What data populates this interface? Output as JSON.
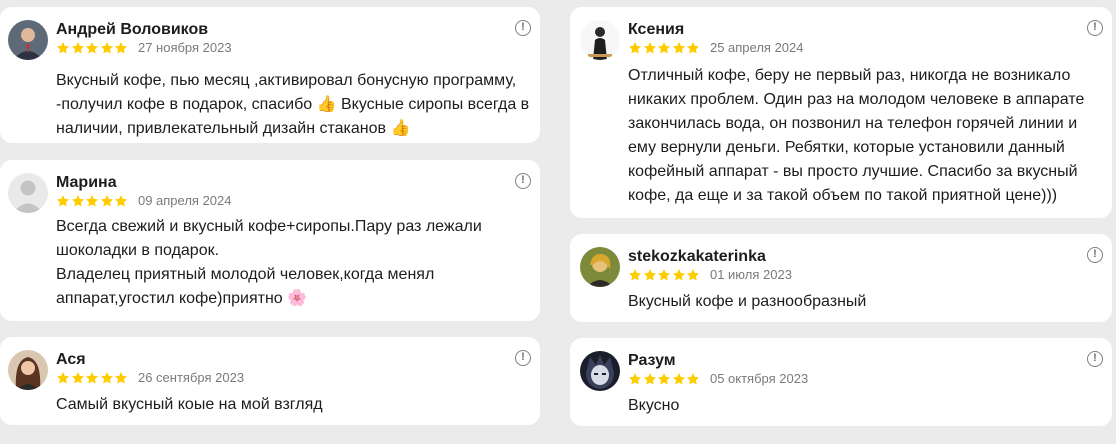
{
  "colors": {
    "page_background": "#ebebeb",
    "card_background": "#ffffff",
    "star": "#ffcc00",
    "date_text": "#7a7a7a",
    "body_text": "#1d1d1d"
  },
  "info_icon_glyph": "!",
  "reviews": [
    {
      "author": "Андрей Воловиков",
      "rating": 5,
      "date": "27 ноября 2023",
      "lines": [
        "Вкусный кофе, пью месяц ,активировал бонусную программу,",
        "-получил кофе в подарок, спасибо 👍  Вкусные сиропы всегда в",
        "наличии, привлекательный дизайн стаканов 👍"
      ]
    },
    {
      "author": "Марина",
      "rating": 5,
      "date": "09 апреля 2024",
      "lines": [
        "Всегда свежий и вкусный кофе+сиропы.Пару раз лежали",
        "шоколадки в подарок.",
        "Владелец приятный молодой человек,когда менял",
        "аппарат,угостил кофе)приятно 🌸"
      ]
    },
    {
      "author": "Ася",
      "rating": 5,
      "date": "26 сентября 2023",
      "lines": [
        "Самый вкусный коые на мой взгляд"
      ]
    },
    {
      "author": "Ксения",
      "rating": 5,
      "date": "25 апреля 2024",
      "lines": [
        "Отличный кофе, беру не первый раз, никогда не возникало",
        "никаких проблем. Один раз на молодом человеке в аппарате",
        "закончилась вода, он позвонил на телефон горячей линии и",
        "ему вернули деньги. Ребятки, которые установили данный",
        "кофейный аппарат - вы просто лучшие. Спасибо за вкусный",
        "кофе, да еще и за такой объем по такой приятной цене)))"
      ]
    },
    {
      "author": "stekozkakaterinka",
      "rating": 5,
      "date": "01 июля 2023",
      "lines": [
        "Вкусный кофе и разнообразный"
      ]
    },
    {
      "author": "Разум",
      "rating": 5,
      "date": "05 октября 2023",
      "lines": [
        "Вкусно"
      ]
    }
  ]
}
